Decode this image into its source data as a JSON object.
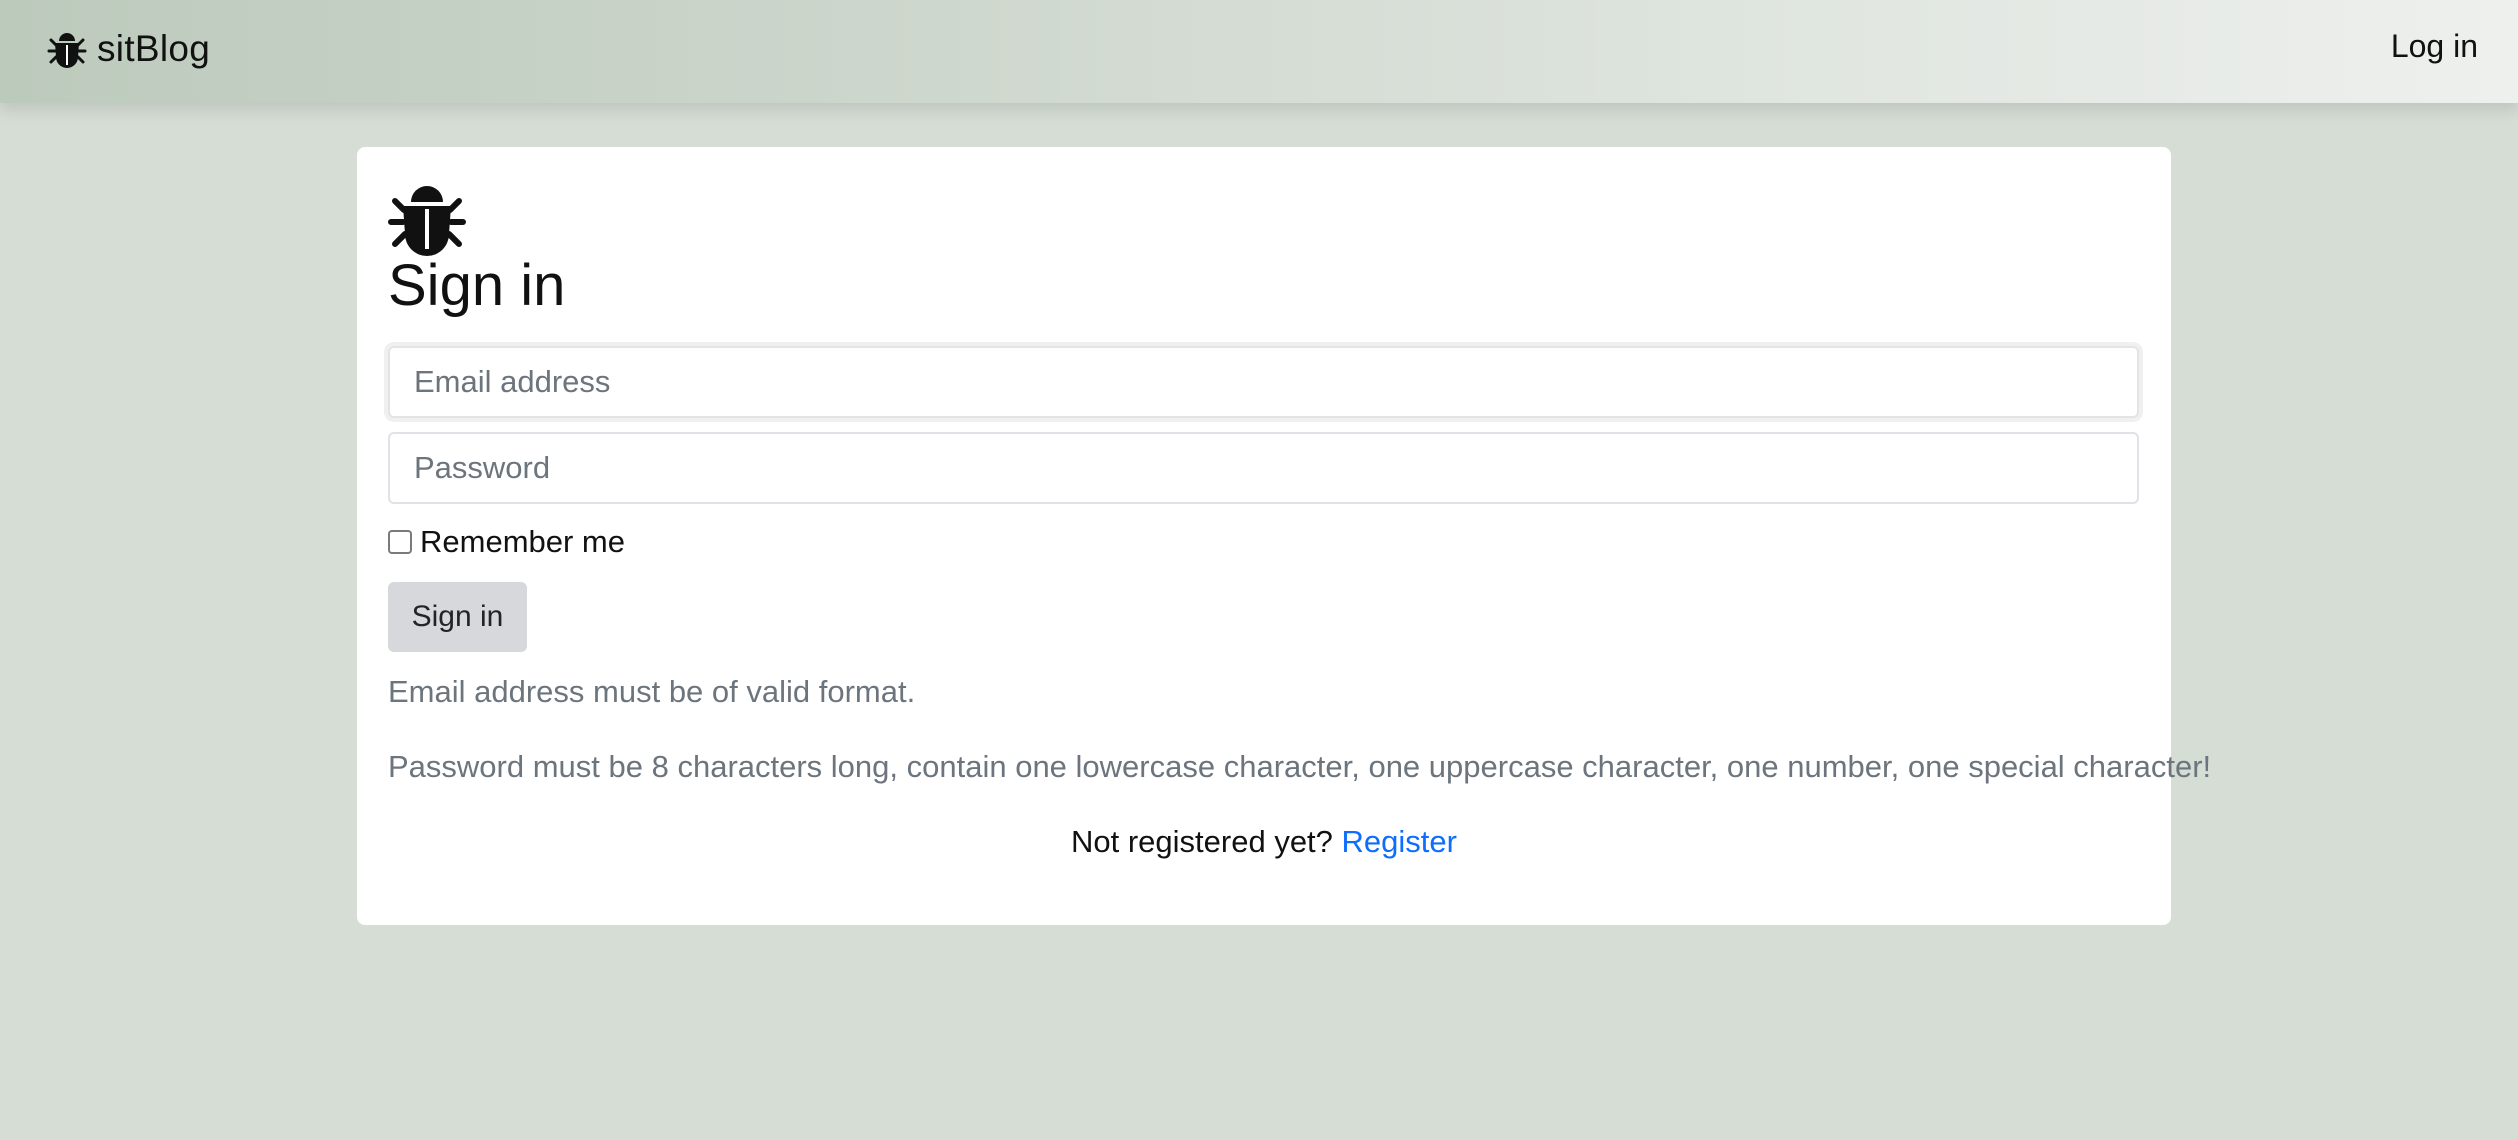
{
  "navbar": {
    "brand_icon": "bug-icon",
    "brand_text": "sitBlog",
    "login_label": "Log in"
  },
  "signin_card": {
    "logo_icon": "bug-icon",
    "title": "Sign in",
    "email_placeholder": "Email address",
    "email_value": "",
    "password_placeholder": "Password",
    "password_value": "",
    "remember_label": "Remember me",
    "remember_checked": false,
    "submit_label": "Sign in",
    "email_hint": "Email address must be of valid format.",
    "password_hint": "Password must be 8 characters long, contain one lowercase character, one uppercase character, one number, one special character!",
    "register_prompt": "Not registered yet?",
    "register_link": "Register"
  },
  "colors": {
    "page_background": "#d5ddd5",
    "link": "#0d6efd",
    "muted_text": "#6c757d",
    "button_background": "#d6d8db"
  }
}
